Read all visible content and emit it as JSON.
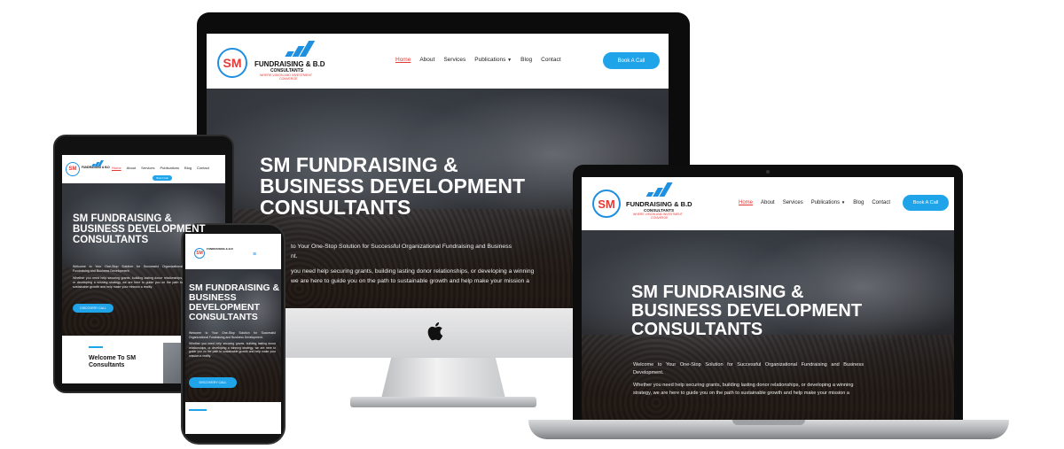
{
  "brand": {
    "name": "FUNDRAISING & B.D",
    "sub": "CONSULTANTS",
    "tagline_line1": "WHERE VISION AND INVESTMENT",
    "tagline_line2": "CONVERGE",
    "monogram": "SM"
  },
  "nav": {
    "items": [
      "Home",
      "About",
      "Services",
      "Publications",
      "Blog",
      "Contact"
    ],
    "cta": "Book A Call"
  },
  "hero": {
    "title_line1": "SM FUNDRAISING &",
    "title_line2": "BUSINESS DEVELOPMENT",
    "title_line3": "CONSULTANTS",
    "para1": "Welcome to Your One-Stop Solution for Successful Organizational Fundraising and Business Development.",
    "para2": "Whether you need help securing grants, building lasting donor relationships, or developing a winning strategy, we are here to guide you on the path to sustainable growth and help make your mission a reality.",
    "imac_para1_cut": "to Your One-Stop Solution for Successful Organizational Fundraising and Business",
    "imac_para1_end": "nt.",
    "imac_para2_cut": "you need help securing grants, building lasting donor relationships, or developing a winning",
    "imac_para2_cut2": "we are here to guide you on the path to sustainable growth and help make your mission a",
    "laptop_para2_a": "Whether you need help securing grants, building lasting donor relationships, or developing a winning",
    "laptop_para2_b": "strategy, we are here to guide you on the path to sustainable growth and help make your mission a",
    "cta": "DISCOVERY CALL"
  },
  "tablet": {
    "welcome_line1": "Welcome To SM",
    "welcome_line2": "Consultants"
  },
  "colors": {
    "accent": "#1fa4ea",
    "brand_blue": "#1f8fe0",
    "brand_red": "#e53935"
  }
}
